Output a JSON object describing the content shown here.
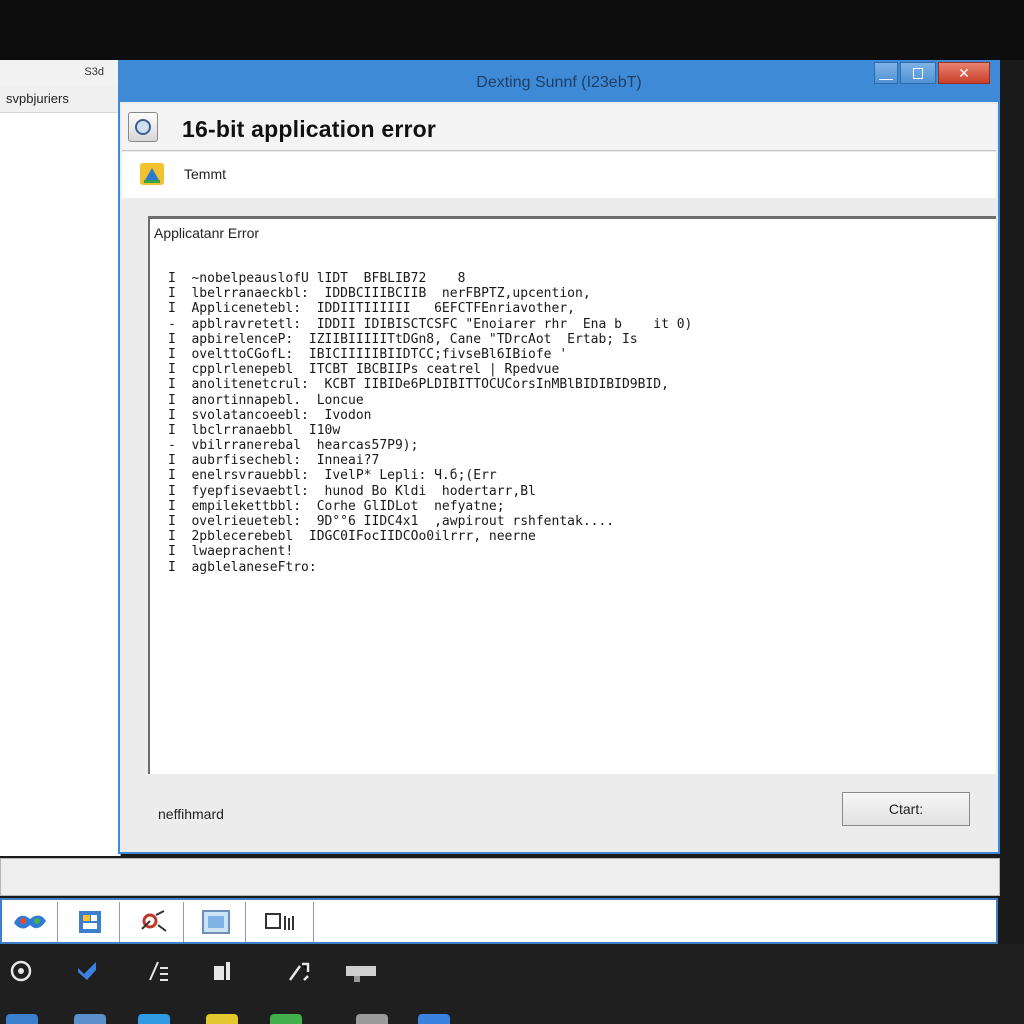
{
  "background_window": {
    "code": "S3d",
    "label": "svpbjuriers"
  },
  "dialog": {
    "window_title": "Dexting Sunnf (I23ebT)",
    "minimize_glyph": "—",
    "close_glyph": "✕",
    "header_title": "16-bit  application error",
    "subheader_label": "Temmt",
    "panel_label": "Applicatanr Error",
    "log_lines": [
      "I  ~nobelpeauslofU lIDT  BFBLIB72    8",
      "I  lbelrranaeckbl:  IDDBCIIIBCIIB  nerFBPTZ,upcention,",
      "I  Applicenetebl:  IDDIITIIIIII   6EFCTFEnriavother,",
      "-  apblravretetl:  IDDII IDIBISCTCSFC \"Enoiarer rhr  Ena b    it 0)",
      "I  apbirelenceP:  IZIIBIIIIITtDGn8, Cane \"TDrcAot  Ertab; Is",
      "I  ovelttoCGofL:  IBICIIIIIBIIDTCC;fivseBl6IBiofe '",
      "I  cpplrlenepebl  ITCBT IBCBIIPs ceatrel | Rpedvue",
      "I  anolitenetcrul:  KCBT IIBIDe6PLDIBITTOCUCorsInMBlBIDIBID9BID,",
      "I  anortinnapebl.  Loncue",
      "I  svolatancoeebl:  Ivodon",
      "I  lbclrranaebbl  I10w",
      "-  vbilrranerebal  hearcas57P9);",
      "I  aubrfisechebl:  Inneai?7",
      "I  enelrsvrauebbl:  IvelP* Lepli: Ч.б;(Err",
      "I  fyepfisevaebtl:  hunod Bo Kldi  hodertarr,Bl",
      "I  empilekettbbl:  Corhe GlIDLot  nefyatne;",
      "I  ovelrieuetebl:  9D°°6 IIDC4x1  ,awpirout rshfentak....",
      "I  2pblecerebebl  IDGC0IFocIIDCOo0ilrrr, neerne",
      "I  lwaeprachent!",
      "I  agblelaneseFtro:"
    ],
    "footer_label": "neffihmard",
    "ok_button_label": "Ctart:"
  },
  "colors": {
    "titlebar_blue": "#3e8ad6",
    "close_red": "#c9402b",
    "client_gray": "#ececec"
  },
  "taskbar": {
    "buttons": [
      "start-orb-icon",
      "chart-app-icon",
      "tools-app-icon",
      "window-app-icon",
      "printer-app-icon"
    ]
  },
  "tray": {
    "icons": [
      "gear-icon",
      "shield-icon",
      "pen-icon",
      "phone-icon",
      "wrench-icon",
      "device-icon"
    ]
  }
}
